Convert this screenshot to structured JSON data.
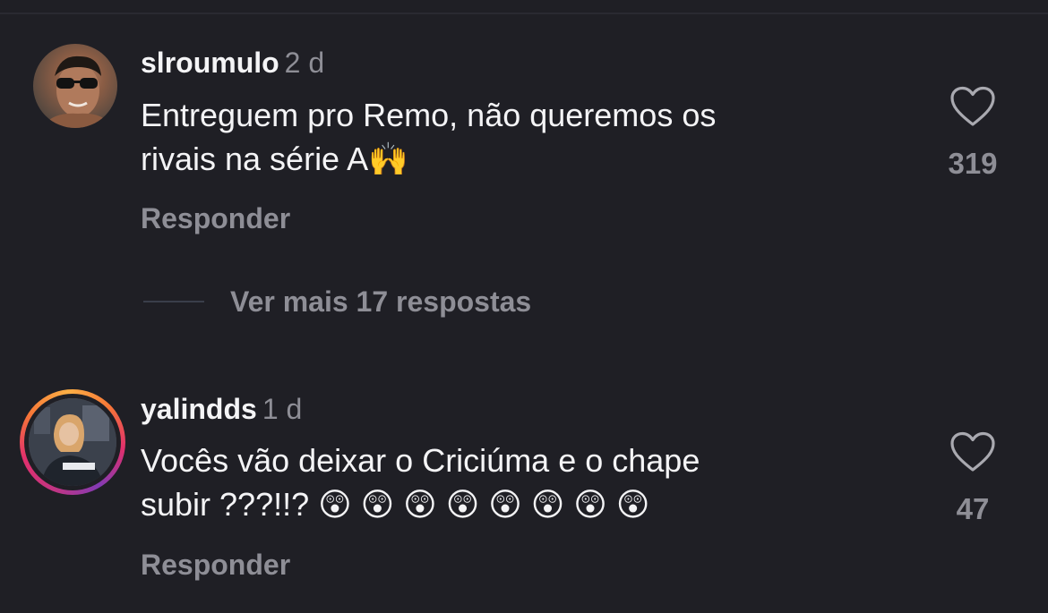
{
  "comments": [
    {
      "username": "slroumulo",
      "time": "2 d",
      "text_line1": "Entreguem pro Remo, não queremos os",
      "text_line2": "rivais na série A🙌",
      "reply_label": "Responder",
      "likes": "319",
      "avatar_icon": "avatar-photo-man-sunglasses"
    },
    {
      "username": "yalindds",
      "time": "1 d",
      "text_line1": "Vocês vão deixar o Criciúma e o chape",
      "text_line2": "subir ???!!? 😲 😲 😲 😲 😲 😲 😲 😲",
      "reply_label": "Responder",
      "likes": "47",
      "avatar_icon": "avatar-photo-woman-story-ring"
    }
  ],
  "more_replies_label": "Ver mais 17 respostas",
  "colors": {
    "background": "#1f1f25",
    "text_primary": "#f4f4f6",
    "text_secondary": "#8e8e96"
  }
}
